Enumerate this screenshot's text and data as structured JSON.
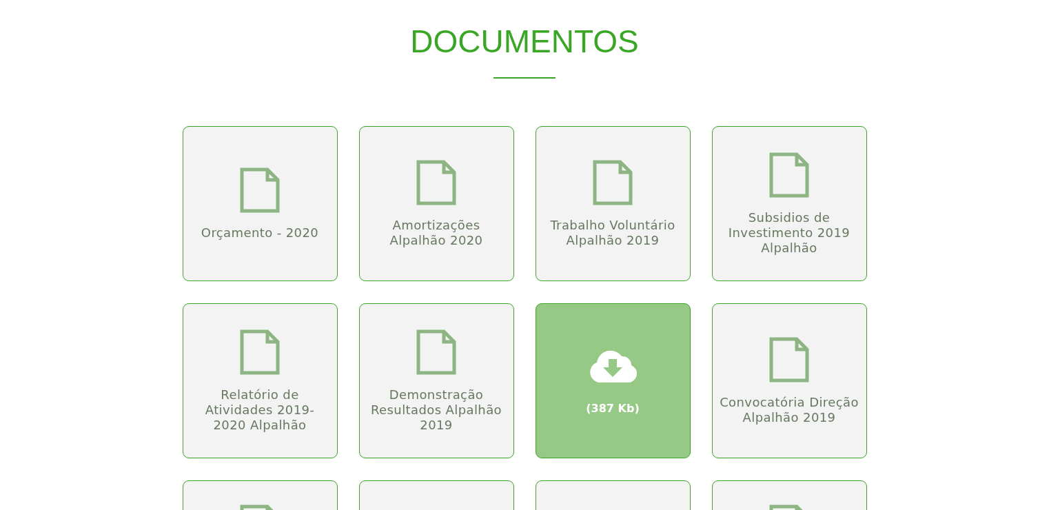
{
  "heading": "DOCUMENTOS",
  "cards": [
    {
      "kind": "document",
      "title": "Orçamento - 2020"
    },
    {
      "kind": "document",
      "title": "Amortizações Alpalhão 2020"
    },
    {
      "kind": "document",
      "title": "Trabalho Voluntário Alpalhão 2019"
    },
    {
      "kind": "document",
      "title": "Subsidios de Investimento 2019 Alpalhão"
    },
    {
      "kind": "document",
      "title": "Relatório de Atividades 2019-2020 Alpalhão"
    },
    {
      "kind": "document",
      "title": "Demonstração Resultados Alpalhão 2019"
    },
    {
      "kind": "download",
      "size": "(387 Kb)"
    },
    {
      "kind": "document",
      "title": "Convocatória Direção Alpalhão 2019"
    },
    {
      "kind": "cut",
      "icon": true
    },
    {
      "kind": "cut",
      "icon": false
    },
    {
      "kind": "cut",
      "icon": false
    },
    {
      "kind": "cut",
      "icon": true
    }
  ]
}
